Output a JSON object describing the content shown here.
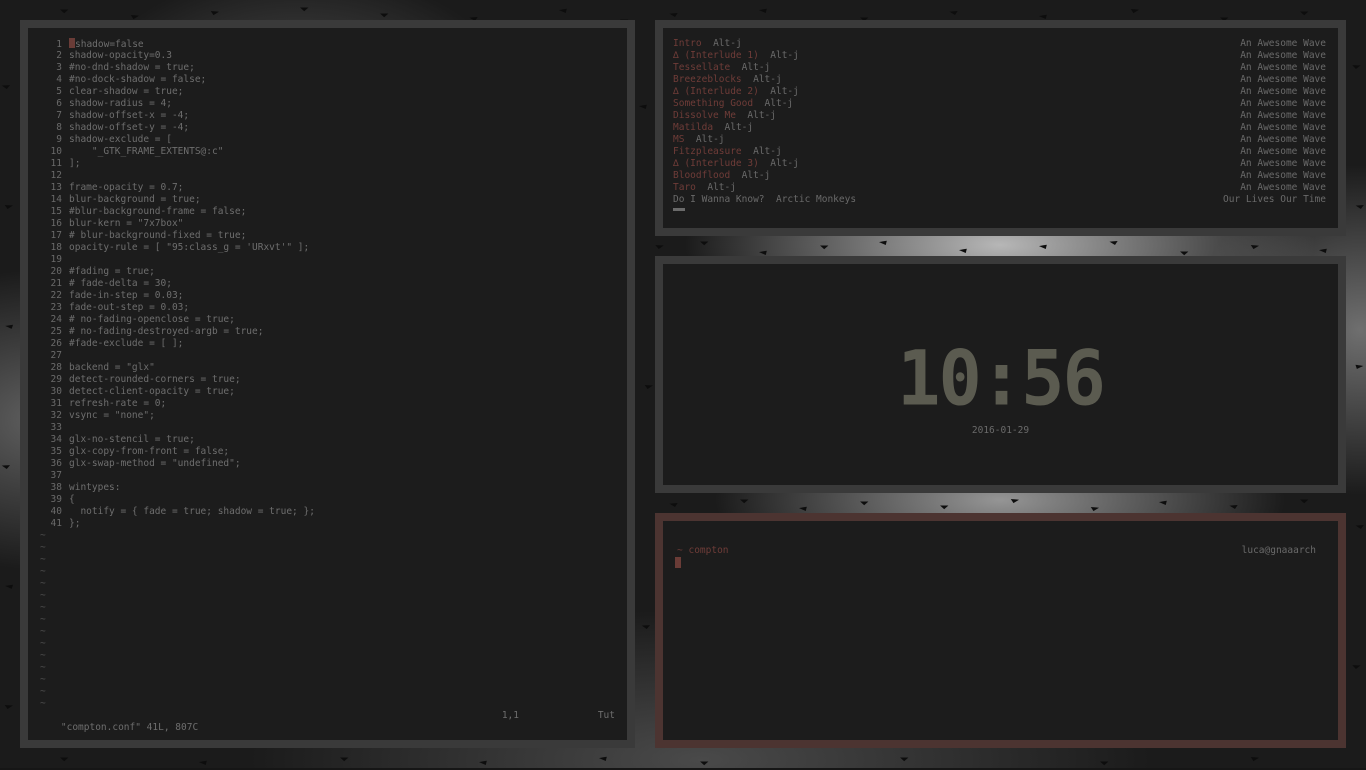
{
  "editor": {
    "lines": [
      {
        "n": "1",
        "t": "shadow=false",
        "cursor": true
      },
      {
        "n": "2",
        "t": "shadow-opacity=0.3"
      },
      {
        "n": "3",
        "t": "#no-dnd-shadow = true;"
      },
      {
        "n": "4",
        "t": "#no-dock-shadow = false;"
      },
      {
        "n": "5",
        "t": "clear-shadow = true;"
      },
      {
        "n": "6",
        "t": "shadow-radius = 4;"
      },
      {
        "n": "7",
        "t": "shadow-offset-x = -4;"
      },
      {
        "n": "8",
        "t": "shadow-offset-y = -4;"
      },
      {
        "n": "9",
        "t": "shadow-exclude = ["
      },
      {
        "n": "10",
        "t": "    \"_GTK_FRAME_EXTENTS@:c\""
      },
      {
        "n": "11",
        "t": "];"
      },
      {
        "n": "12",
        "t": ""
      },
      {
        "n": "13",
        "t": "frame-opacity = 0.7;"
      },
      {
        "n": "14",
        "t": "blur-background = true;"
      },
      {
        "n": "15",
        "t": "#blur-background-frame = false;"
      },
      {
        "n": "16",
        "t": "blur-kern = \"7x7box\""
      },
      {
        "n": "17",
        "t": "# blur-background-fixed = true;"
      },
      {
        "n": "18",
        "t": "opacity-rule = [ \"95:class_g = 'URxvt'\" ];"
      },
      {
        "n": "19",
        "t": ""
      },
      {
        "n": "20",
        "t": "#fading = true;"
      },
      {
        "n": "21",
        "t": "# fade-delta = 30;"
      },
      {
        "n": "22",
        "t": "fade-in-step = 0.03;"
      },
      {
        "n": "23",
        "t": "fade-out-step = 0.03;"
      },
      {
        "n": "24",
        "t": "# no-fading-openclose = true;"
      },
      {
        "n": "25",
        "t": "# no-fading-destroyed-argb = true;"
      },
      {
        "n": "26",
        "t": "#fade-exclude = [ ];"
      },
      {
        "n": "27",
        "t": ""
      },
      {
        "n": "28",
        "t": "backend = \"glx\""
      },
      {
        "n": "29",
        "t": "detect-rounded-corners = true;"
      },
      {
        "n": "30",
        "t": "detect-client-opacity = true;"
      },
      {
        "n": "31",
        "t": "refresh-rate = 0;"
      },
      {
        "n": "32",
        "t": "vsync = \"none\";"
      },
      {
        "n": "33",
        "t": ""
      },
      {
        "n": "34",
        "t": "glx-no-stencil = true;"
      },
      {
        "n": "35",
        "t": "glx-copy-from-front = false;"
      },
      {
        "n": "36",
        "t": "glx-swap-method = \"undefined\";"
      },
      {
        "n": "37",
        "t": ""
      },
      {
        "n": "38",
        "t": "wintypes:"
      },
      {
        "n": "39",
        "t": "{"
      },
      {
        "n": "40",
        "t": "  notify = { fade = true; shadow = true; };"
      },
      {
        "n": "41",
        "t": "};"
      }
    ],
    "tildes": [
      "~",
      "~",
      "~",
      "~",
      "~",
      "~",
      "~",
      "~",
      "~",
      "~",
      "~",
      "~",
      "~",
      "~",
      "~"
    ],
    "status": {
      "file": "\"compton.conf\" 41L, 807C",
      "position": "1,1",
      "percent": "Tut"
    }
  },
  "playlist": {
    "tracks": [
      {
        "title": "Intro",
        "artist": "Alt-j",
        "album": "An Awesome Wave"
      },
      {
        "title": "∆ (Interlude 1)",
        "artist": "Alt-j",
        "album": "An Awesome Wave"
      },
      {
        "title": "Tessellate",
        "artist": "Alt-j",
        "album": "An Awesome Wave"
      },
      {
        "title": "Breezeblocks",
        "artist": "Alt-j",
        "album": "An Awesome Wave"
      },
      {
        "title": "∆ (Interlude 2)",
        "artist": "Alt-j",
        "album": "An Awesome Wave"
      },
      {
        "title": "Something Good",
        "artist": "Alt-j",
        "album": "An Awesome Wave"
      },
      {
        "title": "Dissolve Me",
        "artist": "Alt-j",
        "album": "An Awesome Wave"
      },
      {
        "title": "Matilda",
        "artist": "Alt-j",
        "album": "An Awesome Wave"
      },
      {
        "title": "MS",
        "artist": "Alt-j",
        "album": "An Awesome Wave"
      },
      {
        "title": "Fitzpleasure",
        "artist": "Alt-j",
        "album": "An Awesome Wave"
      },
      {
        "title": "∆ (Interlude 3)",
        "artist": "Alt-j",
        "album": "An Awesome Wave"
      },
      {
        "title": "Bloodflood",
        "artist": "Alt-j",
        "album": "An Awesome Wave"
      },
      {
        "title": "Taro",
        "artist": "Alt-j",
        "album": "An Awesome Wave"
      },
      {
        "title": "Do I Wanna Know?",
        "artist": "Arctic Monkeys",
        "album": "Our Lives Our Time",
        "playing": true
      }
    ]
  },
  "clock": {
    "time": "10:56",
    "date": "2016-01-29"
  },
  "terminal": {
    "prompt_symbol": "~",
    "directory": "compton",
    "host": "luca@gnaaarch"
  },
  "colors": {
    "accent": "#6f3c38",
    "text": "#6e6e6e",
    "border": "#3a3a3a",
    "active_border": "#4c3431",
    "background": "#1c1c1c"
  }
}
